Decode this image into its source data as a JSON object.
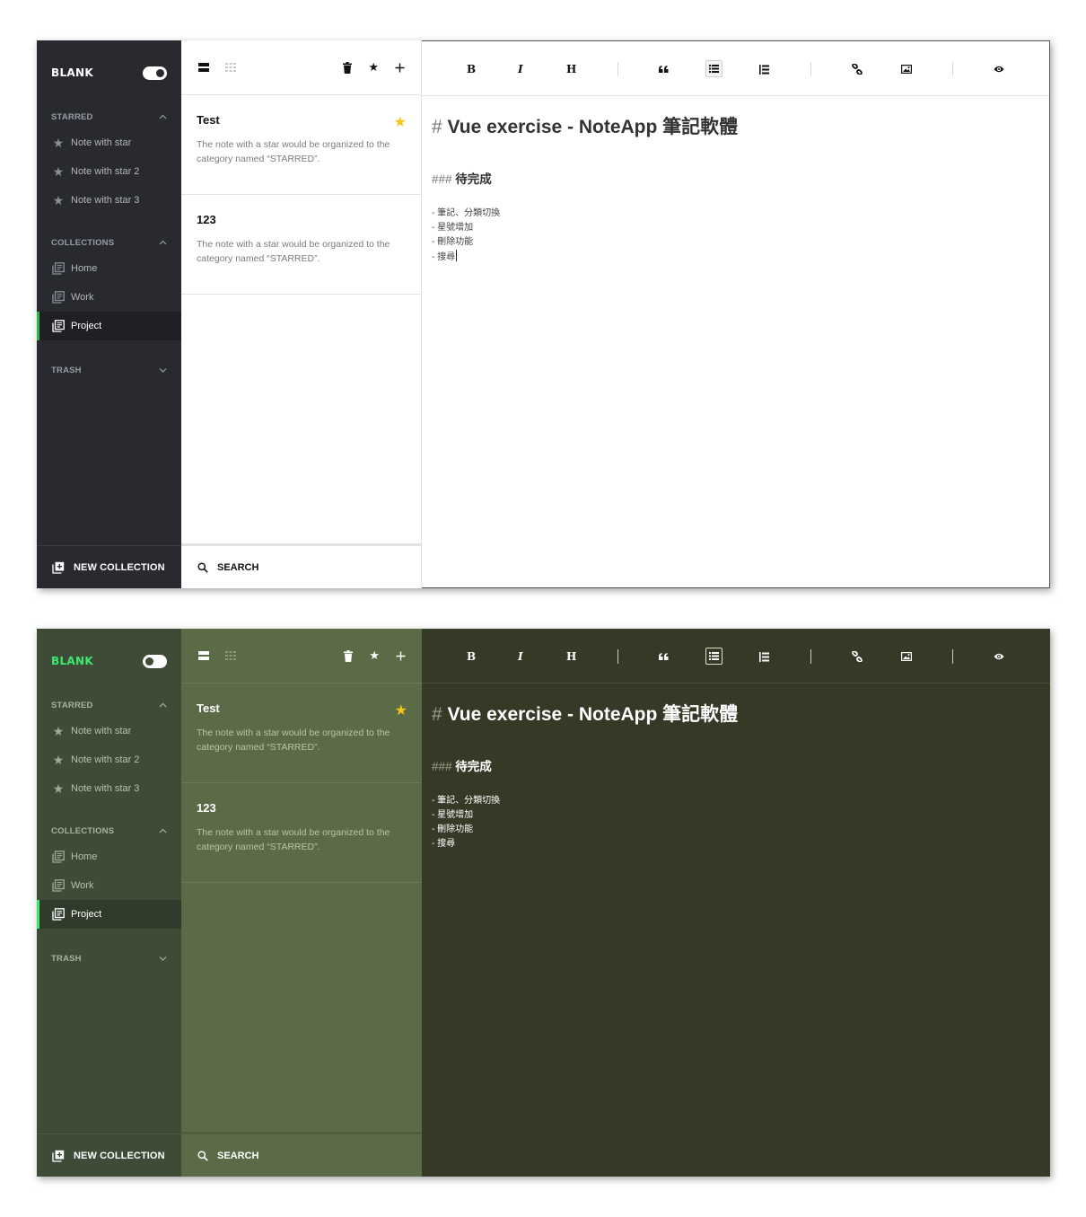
{
  "brand": "BLANK",
  "sections": {
    "starred": "STARRED",
    "collections": "COLLECTIONS",
    "trash": "TRASH"
  },
  "starred_items": [
    {
      "label": "Note with star"
    },
    {
      "label": "Note with star 2"
    },
    {
      "label": "Note with star 3"
    }
  ],
  "collection_items": [
    {
      "label": "Home"
    },
    {
      "label": "Work"
    },
    {
      "label": "Project"
    }
  ],
  "active_collection": "Project",
  "new_collection_label": "NEW COLLECTION",
  "search_label": "SEARCH",
  "notes": [
    {
      "title": "Test",
      "preview": "The note with a star would be organized to the category named “STARRED”.",
      "starred": true
    },
    {
      "title": "123",
      "preview": "The note with a star would be organized to the category named “STARRED”.",
      "starred": false
    }
  ],
  "toolbar": {
    "bold": "B",
    "italic": "I",
    "heading": "H"
  },
  "editor": {
    "h1_mark": "#",
    "h1_text": "Vue exercise - NoteApp 筆記軟體",
    "h3_mark": "###",
    "h3_text": "待完成",
    "bullets": [
      "- 筆記、分類切換",
      "- 星號增加",
      "- 刪除功能",
      "- 搜尋"
    ]
  },
  "themes": [
    {
      "name": "light",
      "sidebar": "#282a30",
      "accent": "#2ab84a",
      "editor": "#ffffff",
      "toggle_on": true
    },
    {
      "name": "dark",
      "sidebar": "#3e4c37",
      "accent": "#3dea6e",
      "list": "#5b6b47",
      "editor": "#353a27",
      "toggle_on": false
    }
  ],
  "icons": {
    "star": "star-icon",
    "collection": "collection-icon",
    "trash": "trash-icon",
    "add": "plus-icon",
    "search": "search-icon",
    "list_view": "list-view-icon",
    "grid_view": "grid-view-icon",
    "quote": "quote-icon",
    "unordered_list": "unordered-list-icon",
    "ordered_list": "ordered-list-icon",
    "link": "link-icon",
    "image": "image-icon",
    "preview": "eye-icon"
  }
}
